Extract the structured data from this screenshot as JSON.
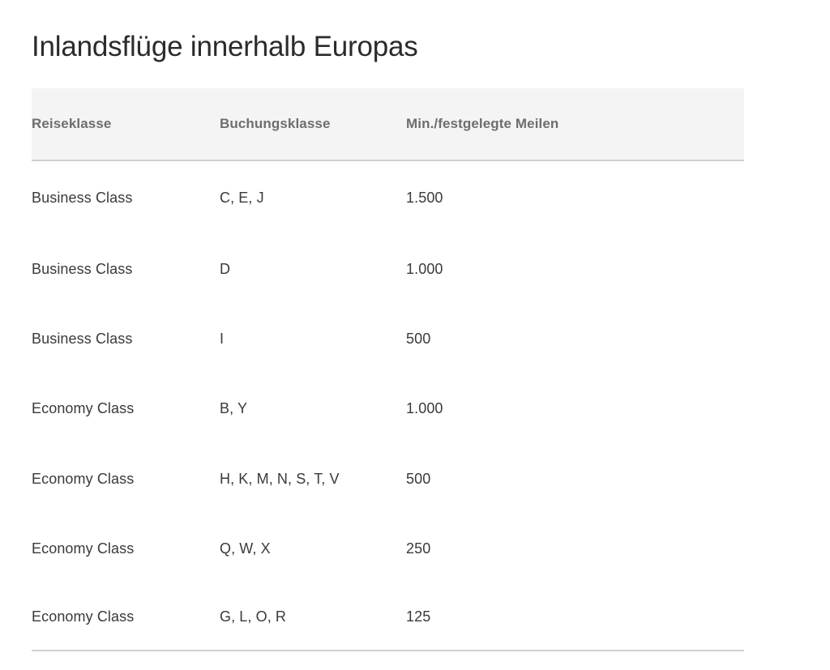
{
  "page": {
    "title": "Inlandsflüge innerhalb Europas",
    "background_color": "#ffffff",
    "header_background_color": "#f4f4f4",
    "header_text_color": "#6e6e6e",
    "body_text_color": "#3a3a3a",
    "border_color": "#cfcfcf"
  },
  "table": {
    "columns": [
      {
        "key": "travel_class",
        "label": "Reiseklasse"
      },
      {
        "key": "booking_class",
        "label": "Buchungsklasse"
      },
      {
        "key": "miles",
        "label": "Min./festgelegte Meilen"
      }
    ],
    "rows": [
      {
        "travel_class": "Business Class",
        "booking_class": "C, E, J",
        "miles": "1.500"
      },
      {
        "travel_class": "Business Class",
        "booking_class": "D",
        "miles": "1.000"
      },
      {
        "travel_class": "Business Class",
        "booking_class": "I",
        "miles": "500"
      },
      {
        "travel_class": "Economy Class",
        "booking_class": "B, Y",
        "miles": "1.000"
      },
      {
        "travel_class": "Economy Class",
        "booking_class": "H, K, M, N, S, T, V",
        "miles": "500"
      },
      {
        "travel_class": "Economy Class",
        "booking_class": "Q, W, X",
        "miles": "250"
      },
      {
        "travel_class": "Economy Class",
        "booking_class": "G, L, O, R",
        "miles": "125"
      }
    ]
  }
}
